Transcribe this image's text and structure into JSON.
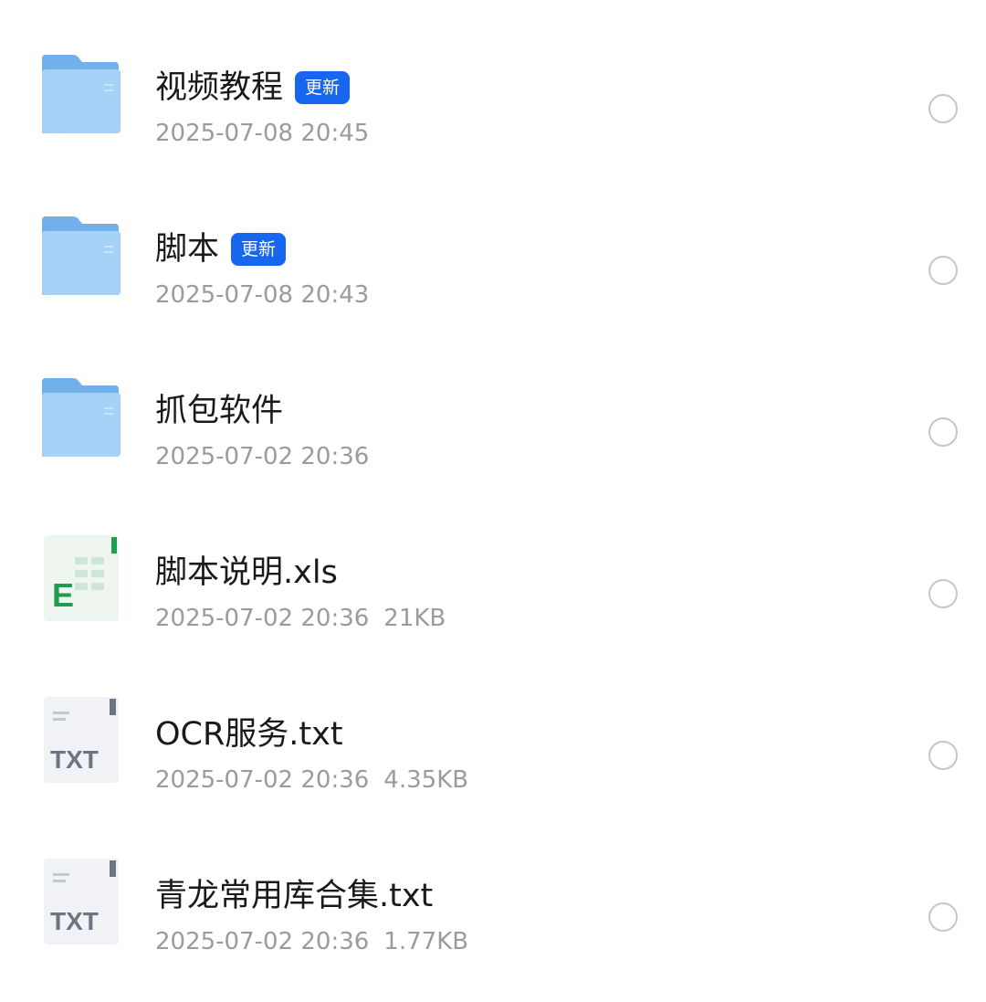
{
  "files": [
    {
      "type": "folder",
      "name": "视频教程",
      "badge": "更新",
      "date": "2025-07-08 20:45",
      "size": ""
    },
    {
      "type": "folder",
      "name": "脚本",
      "badge": "更新",
      "date": "2025-07-08 20:43",
      "size": ""
    },
    {
      "type": "folder",
      "name": "抓包软件",
      "badge": "",
      "date": "2025-07-02 20:36",
      "size": ""
    },
    {
      "type": "excel",
      "name": "脚本说明.xls",
      "badge": "",
      "date": "2025-07-02 20:36",
      "size": "21KB",
      "icon_letter": "E"
    },
    {
      "type": "txt",
      "name": "OCR服务.txt",
      "badge": "",
      "date": "2025-07-02 20:36",
      "size": "4.35KB",
      "icon_text": "TXT"
    },
    {
      "type": "txt",
      "name": "青龙常用库合集.txt",
      "badge": "",
      "date": "2025-07-02 20:36",
      "size": "1.77KB",
      "icon_text": "TXT"
    }
  ],
  "colors": {
    "badge": "#1766f0",
    "folder": "#8cc4f5",
    "excel_green": "#1f9c4f",
    "txt_gray": "#6b7684",
    "meta_text": "#9b9b9b",
    "name_text": "#1a1a1a"
  },
  "icons": {
    "folder": "folder-icon",
    "excel": "excel-file-icon",
    "txt": "txt-file-icon",
    "select": "select-circle-icon"
  }
}
